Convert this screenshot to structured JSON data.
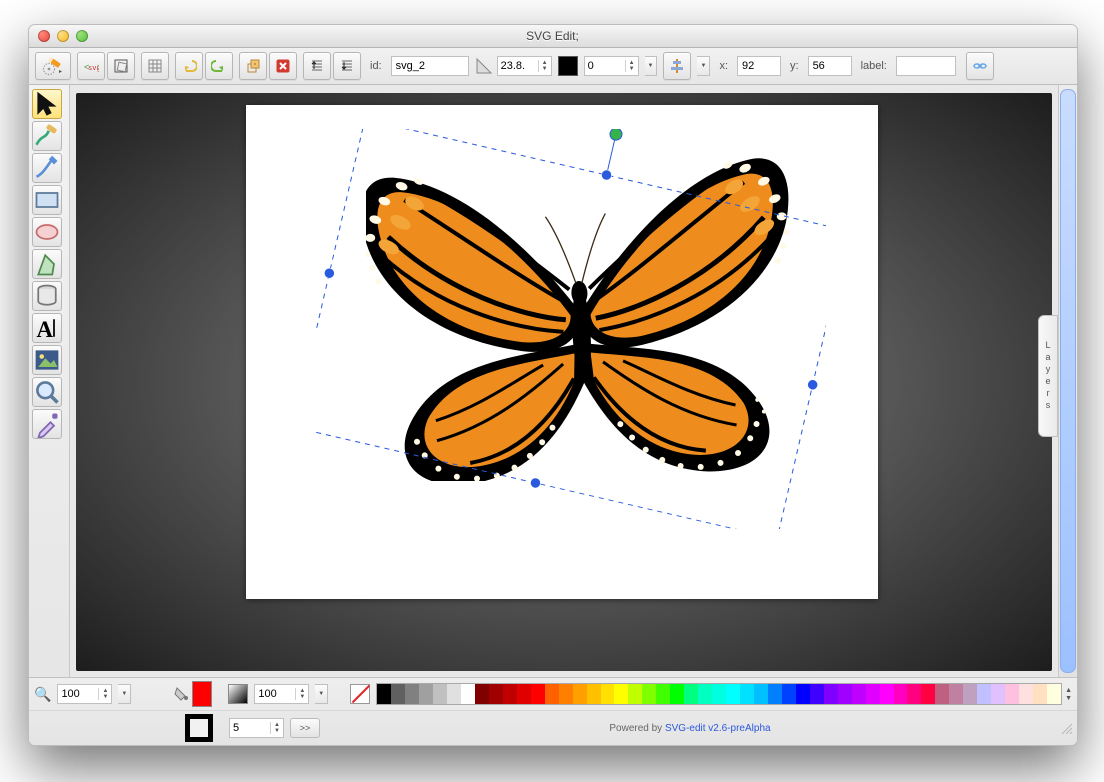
{
  "window": {
    "title": "SVG Edit;"
  },
  "toolbar": {
    "id_label": "id:",
    "id_value": "svg_2",
    "angle": "23.8.",
    "blur": "0",
    "x_label": "x:",
    "x": "92",
    "y_label": "y:",
    "y": "56",
    "label_label": "label:",
    "label_value": ""
  },
  "tool_names": {
    "select": "Select",
    "draw": "Freehand",
    "path": "Path",
    "rect": "Rectangle",
    "ellipse": "Ellipse",
    "polygon": "Polygon",
    "cylinder": "Cylinder",
    "text": "Text",
    "image": "Image",
    "zoom": "Zoom",
    "eyedrop": "Eyedropper"
  },
  "palette": [
    "#000000",
    "#606060",
    "#808080",
    "#a0a0a0",
    "#c0c0c0",
    "#e0e0e0",
    "#ffffff",
    "#800000",
    "#a00000",
    "#c00000",
    "#e00000",
    "#ff0000",
    "#ff6000",
    "#ff8000",
    "#ffa000",
    "#ffc000",
    "#ffe000",
    "#ffff00",
    "#c0ff00",
    "#80ff00",
    "#40ff00",
    "#00ff00",
    "#00ff80",
    "#00ffc0",
    "#00ffe0",
    "#00ffff",
    "#00e0ff",
    "#00c0ff",
    "#0080ff",
    "#0040ff",
    "#0000ff",
    "#4000ff",
    "#8000ff",
    "#a000ff",
    "#c000ff",
    "#e000ff",
    "#ff00ff",
    "#ff00c0",
    "#ff0080",
    "#ff0040",
    "#c06080",
    "#c080a0",
    "#c0a0c0",
    "#c0c0ff",
    "#e0c0ff",
    "#ffc0e0",
    "#ffe0e0",
    "#ffe0c0",
    "#ffffe0"
  ],
  "footer": {
    "zoom": "100",
    "opacity": "100",
    "stroke_width": "5",
    "powered_by": "Powered by ",
    "powered_link": "SVG-edit v2.6-preAlpha"
  },
  "side": {
    "layers_label": "Layers"
  }
}
